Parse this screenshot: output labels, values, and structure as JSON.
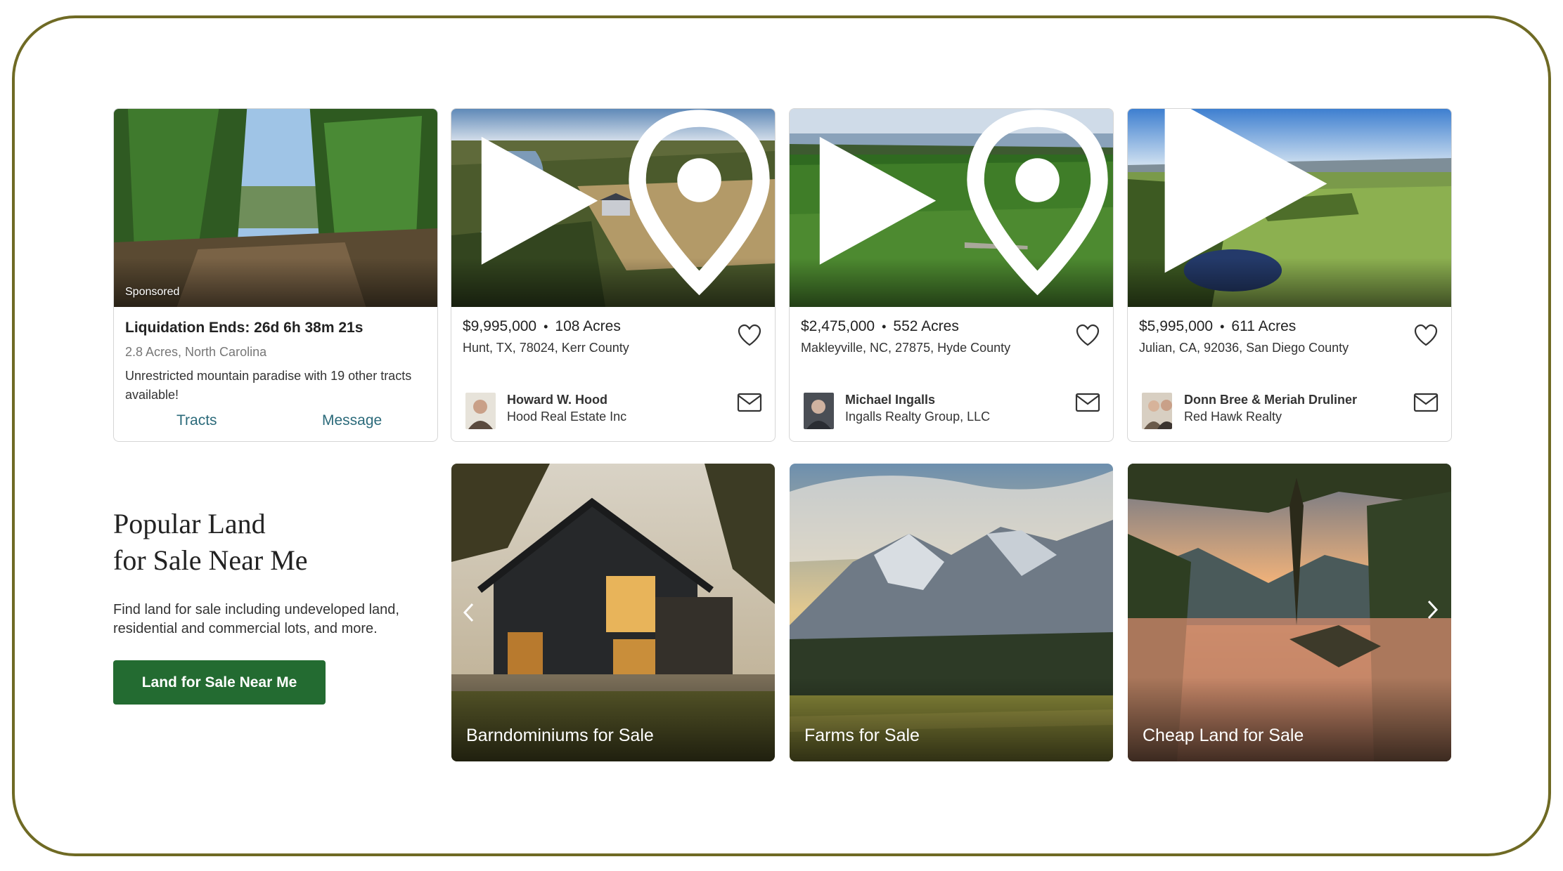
{
  "listings": [
    {
      "sponsored_label": "Sponsored",
      "headline": "Liquidation Ends: 26d 6h 38m 21s",
      "subtitle": "2.8 Acres, North Carolina",
      "description": "Unrestricted mountain paradise with 19 other tracts available!",
      "links": [
        "Tracts",
        "Message"
      ]
    },
    {
      "price": "$9,995,000",
      "separator": "•",
      "acres": "108 Acres",
      "location": "Hunt, TX, 78024, Kerr County",
      "agent_name": "Howard W. Hood",
      "agent_company": "Hood Real Estate Inc",
      "media": [
        "video-icon",
        "map-pin-icon"
      ]
    },
    {
      "price": "$2,475,000",
      "separator": "•",
      "acres": "552 Acres",
      "location": "Makleyville, NC, 27875, Hyde County",
      "agent_name": "Michael Ingalls",
      "agent_company": "Ingalls Realty Group, LLC",
      "media": [
        "video-icon",
        "map-pin-icon"
      ]
    },
    {
      "price": "$5,995,000",
      "separator": "•",
      "acres": "611 Acres",
      "location": "Julian, CA, 92036, San Diego County",
      "agent_name": "Donn Bree & Meriah Druliner",
      "agent_company": "Red Hawk Realty",
      "media": [
        "video-icon"
      ]
    }
  ],
  "popular": {
    "title_line1": "Popular Land",
    "title_line2": "for Sale Near Me",
    "description": "Find land for sale including undeveloped land, residential and commercial lots, and more.",
    "button_label": "Land for Sale Near Me"
  },
  "categories": [
    {
      "label": "Barndominiums for Sale"
    },
    {
      "label": "Farms for Sale"
    },
    {
      "label": "Cheap Land for Sale"
    }
  ],
  "colors": {
    "frame_border": "#6f6a24",
    "primary_button": "#236b31",
    "link": "#2b6a7a"
  }
}
